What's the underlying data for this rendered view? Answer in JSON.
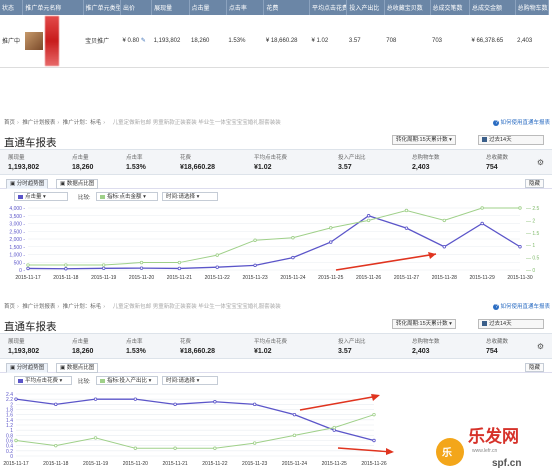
{
  "promo_table": {
    "headers": [
      "状态",
      "推广单元名称",
      "推广单元类型",
      "出价",
      "展现量",
      "点击量",
      "点击率",
      "花费",
      "平均点击花费",
      "投入产出比",
      "总收藏宝贝数",
      "总成交笔数",
      "总成交金额",
      "总购物车数"
    ],
    "row": {
      "status": "推广中",
      "type": "宝贝推广",
      "bid": "¥ 0.80",
      "impressions": "1,193,802",
      "clicks": "18,260",
      "ctr": "1.53%",
      "cost": "¥ 18,660.28",
      "avg_cpc": "¥ 1.02",
      "roi": "3.57",
      "favorites": "708",
      "orders": "703",
      "gmv": "¥ 66,378.65",
      "cart": "2,403"
    }
  },
  "reports": [
    {
      "breadcrumb": [
        "首页",
        "推广计划报表",
        "推广计划：标毛",
        "儿童定做新包邮 男童新款正装套装 毕业生一体宝宝宝宝婚礼服套装装"
      ],
      "help_text": "如何使用直通车报表",
      "title": "直通车报表",
      "period_label": "转化周期:15天累计数",
      "range_label": "过去14天",
      "metrics": [
        {
          "label": "展现量",
          "value": "1,193,802"
        },
        {
          "label": "点击量",
          "value": "18,260"
        },
        {
          "label": "点击率",
          "value": "1.53%"
        },
        {
          "label": "花费",
          "value": "¥18,660.28"
        },
        {
          "label": "平均点击花费",
          "value": "¥1.02"
        },
        {
          "label": "投入产出比",
          "value": "3.57"
        },
        {
          "label": "总购物车数",
          "value": "2,403"
        },
        {
          "label": "总收藏数",
          "value": "754"
        }
      ],
      "tabs": [
        "分时趋势图",
        "数据点比图"
      ],
      "hide_label": "隐藏",
      "metric_a": "点击量",
      "compare_label": "比较:",
      "metric_b_prefix": "指标:",
      "metric_b": "点击金额",
      "time_prefix": "时间:",
      "time_value": "请选择"
    },
    {
      "breadcrumb": [
        "首页",
        "推广计划报表",
        "推广计划：标毛",
        "儿童定做新包邮 男童新款正装套装 毕业生一体宝宝宝宝婚礼服套装装"
      ],
      "help_text": "如何使用直通车报表",
      "title": "直通车报表",
      "period_label": "转化周期:15天累计数",
      "range_label": "过去14天",
      "metrics": [
        {
          "label": "展现量",
          "value": "1,193,802"
        },
        {
          "label": "点击量",
          "value": "18,260"
        },
        {
          "label": "点击率",
          "value": "1.53%"
        },
        {
          "label": "花费",
          "value": "¥18,660.28"
        },
        {
          "label": "平均点击花费",
          "value": "¥1.02"
        },
        {
          "label": "投入产出比",
          "value": "3.57"
        },
        {
          "label": "总购物车数",
          "value": "2,403"
        },
        {
          "label": "总收藏数",
          "value": "754"
        }
      ],
      "tabs": [
        "分时趋势图",
        "数据点比图"
      ],
      "hide_label": "隐藏",
      "metric_a": "平均点击花费",
      "compare_label": "比较:",
      "metric_b_prefix": "指标:",
      "metric_b": "投入产出比",
      "time_prefix": "时间:",
      "time_value": "请选择"
    }
  ],
  "colors": {
    "series_a": "#5b55c9",
    "series_b": "#9fd089",
    "arrow": "#e0341f",
    "header_bg": "#6b86a6"
  },
  "chart_data": [
    {
      "type": "line",
      "x": [
        "2015-11-17",
        "2015-11-18",
        "2015-11-19",
        "2015-11-20",
        "2015-11-21",
        "2015-11-22",
        "2015-11-23",
        "2015-11-24",
        "2015-11-25",
        "2015-11-26",
        "2015-11-27",
        "2015-11-28",
        "2015-11-29",
        "2015-11-30"
      ],
      "series": [
        {
          "name": "点击量",
          "axis": "left",
          "values": [
            100,
            80,
            110,
            120,
            100,
            180,
            300,
            800,
            1800,
            3500,
            2700,
            1500,
            3000,
            1500
          ]
        },
        {
          "name": "点击金额",
          "axis": "right",
          "values": [
            0.2,
            0.2,
            0.2,
            0.3,
            0.3,
            0.6,
            1.2,
            1.3,
            1.7,
            2.0,
            2.4,
            2.0,
            2.5,
            2.5
          ]
        }
      ],
      "ylim_left": [
        0,
        4000
      ],
      "yticks_left": [
        "4,000 -",
        "3,500 -",
        "3,000 -",
        "2,500 -",
        "2,000 -",
        "1,500 -",
        "1,000 -",
        "500 -",
        "0 -"
      ],
      "ylim_right": [
        0,
        2.5
      ],
      "yticks_right": [
        "2.5",
        "2",
        "1.5",
        "1",
        "0.5",
        "0"
      ],
      "grid": true
    },
    {
      "type": "line",
      "x": [
        "2015-11-17",
        "2015-11-18",
        "2015-11-19",
        "2015-11-20",
        "2015-11-21",
        "2015-11-22",
        "2015-11-23",
        "2015-11-24",
        "2015-11-25",
        "2015-11-26"
      ],
      "series": [
        {
          "name": "平均点击花费",
          "axis": "left",
          "values": [
            2.2,
            2.0,
            2.2,
            2.2,
            2.0,
            2.1,
            2.0,
            1.6,
            1.0,
            0.6
          ]
        },
        {
          "name": "投入产出比",
          "axis": "right",
          "values": [
            0.6,
            0.4,
            0.7,
            0.3,
            0.3,
            0.3,
            0.5,
            0.8,
            1.1,
            1.6
          ]
        }
      ],
      "ylim_left": [
        0,
        2.4
      ],
      "yticks_left": [
        "2.4",
        "2.2",
        "2",
        "1.8",
        "1.6",
        "1.4",
        "1.2",
        "1",
        "0.8",
        "0.6",
        "0.4",
        "0.2",
        "0"
      ],
      "grid": true
    }
  ],
  "watermark": {
    "brand": "乐发网",
    "url": "www.lefr.cn",
    "site": "spf.cn"
  }
}
